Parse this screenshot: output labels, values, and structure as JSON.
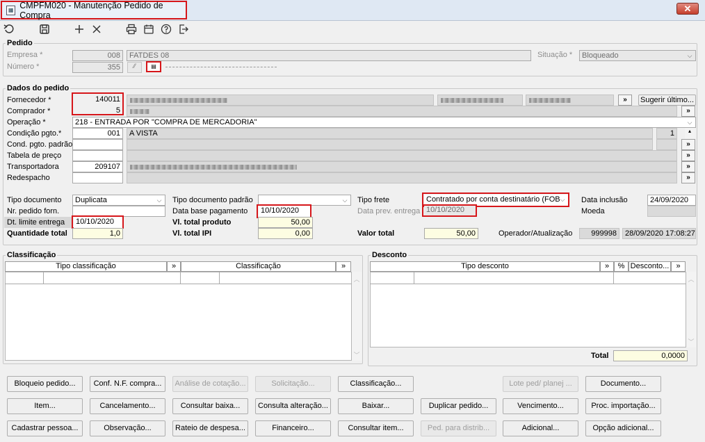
{
  "window": {
    "title": "CMPFM020 - Manutenção Pedido de Compra",
    "close_label": "✕"
  },
  "toolbar": {
    "icons": [
      "undo-icon",
      "save-icon",
      "add-icon",
      "delete-icon",
      "print-icon",
      "calendar-icon",
      "help-icon",
      "exit-icon"
    ]
  },
  "pedido": {
    "group_title": "Pedido",
    "empresa_label": "Empresa *",
    "empresa_code": "008",
    "empresa_name": "FATDES 08",
    "numero_label": "Número *",
    "numero_value": "355",
    "situacao_label": "Situação *",
    "situacao_value": "Bloqueado"
  },
  "dados": {
    "group_title": "Dados do pedido",
    "fornecedor_label": "Fornecedor *",
    "fornecedor_code": "140011",
    "comprador_label": "Comprador *",
    "comprador_code": "5",
    "operacao_label": "Operação *",
    "operacao_value": "218 - ENTRADA POR \"COMPRA DE MERCADORIA\"",
    "condicao_label": "Condição pgto.*",
    "condicao_code": "001",
    "condicao_name": "A VISTA",
    "condicao_parcelas": "1",
    "cond_padrao_label": "Cond. pgto. padrão",
    "tabela_label": "Tabela de preço",
    "transportadora_label": "Transportadora",
    "transportadora_code": "209107",
    "redespacho_label": "Redespacho",
    "sugerir_label": "Sugerir último...",
    "more_label": "»",
    "tipo_documento_label": "Tipo documento",
    "tipo_documento_value": "Duplicata",
    "tipo_doc_padrao_label": "Tipo documento padrão",
    "tipo_frete_label": "Tipo frete",
    "tipo_frete_value": "Contratado por conta destinatário (FOB",
    "data_inclusao_label": "Data inclusão",
    "data_inclusao_value": "24/09/2020",
    "nr_pedido_label": "Nr. pedido forn.",
    "data_base_label": "Data base pagamento",
    "data_base_value": "10/10/2020",
    "data_prev_label": "Data prev. entrega",
    "data_prev_value": "10/10/2020",
    "moeda_label": "Moeda",
    "dt_limite_label": "Dt. limite entrega",
    "dt_limite_value": "10/10/2020",
    "vl_total_produto_label": "Vl. total produto",
    "vl_total_produto_value": "50,00",
    "quantidade_label": "Quantidade total",
    "quantidade_value": "1,0",
    "vl_total_ipi_label": "Vl. total IPI",
    "vl_total_ipi_value": "0,00",
    "valor_total_label": "Valor total",
    "valor_total_value": "50,00",
    "operador_label": "Operador/Atualização",
    "operador_value": "999998",
    "atualizacao_value": "28/09/2020 17:08:27"
  },
  "classificacao": {
    "group_title": "Classificação",
    "col_tipo": "Tipo classificação",
    "col_class": "Classificação",
    "more_label": "»"
  },
  "desconto": {
    "group_title": "Desconto",
    "col_tipo": "Tipo desconto",
    "col_pct": "%",
    "col_desconto": "Desconto...",
    "more_label": "»",
    "total_label": "Total",
    "total_value": "0,0000"
  },
  "buttons": {
    "row1": [
      "Bloqueio pedido...",
      "Conf. N.F. compra...",
      "Análise de cotação...",
      "Solicitação...",
      "Classificação...",
      "Lote ped/ planej ...",
      "Documento..."
    ],
    "row2": [
      "Item...",
      "Cancelamento...",
      "Consultar baixa...",
      "Consulta alteração...",
      "Baixar...",
      "Duplicar pedido...",
      "Vencimento...",
      "Proc. importação..."
    ],
    "row3": [
      "Cadastrar pessoa...",
      "Observação...",
      "Rateio de despesa...",
      "Financeiro...",
      "Consultar item...",
      "Ped. para distrib...",
      "Adicional...",
      "Opção adicional..."
    ]
  }
}
